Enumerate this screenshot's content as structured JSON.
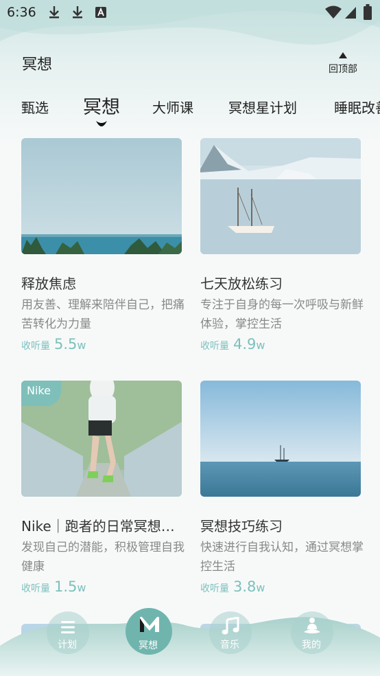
{
  "status_bar": {
    "time": "6:36"
  },
  "header": {
    "title": "冥想",
    "back_to_top": "回顶部"
  },
  "tabs": [
    {
      "label": "甄选"
    },
    {
      "label": "冥想"
    },
    {
      "label": "大师课"
    },
    {
      "label": "冥想星计划"
    },
    {
      "label": "睡眠改善"
    }
  ],
  "cards": [
    {
      "title": "释放焦虑",
      "desc": "用友善、理解来陪伴自己，把痛苦转化为力量",
      "stats_label": "收听量",
      "stats_value": "5.5",
      "stats_unit": "w"
    },
    {
      "title": "七天放松练习",
      "desc": "专注于自身的每一次呼吸与新鲜体验，掌控生活",
      "stats_label": "收听量",
      "stats_value": "4.9",
      "stats_unit": "w"
    },
    {
      "badge": "Nike",
      "title": "Nike｜跑者的日常冥想…",
      "desc": "发现自己的潜能，积极管理自我健康",
      "stats_label": "收听量",
      "stats_value": "1.5",
      "stats_unit": "w"
    },
    {
      "title": "冥想技巧练习",
      "desc": "快速进行自我认知，通过冥想掌控生活",
      "stats_label": "收听量",
      "stats_value": "3.8",
      "stats_unit": "w"
    }
  ],
  "bottom_nav": [
    {
      "label": "计划"
    },
    {
      "label": "冥想",
      "active": true
    },
    {
      "label": "音乐"
    },
    {
      "label": "我的"
    }
  ],
  "colors": {
    "accent": "#7ebfba",
    "nav_active": "#6fb5ae"
  }
}
